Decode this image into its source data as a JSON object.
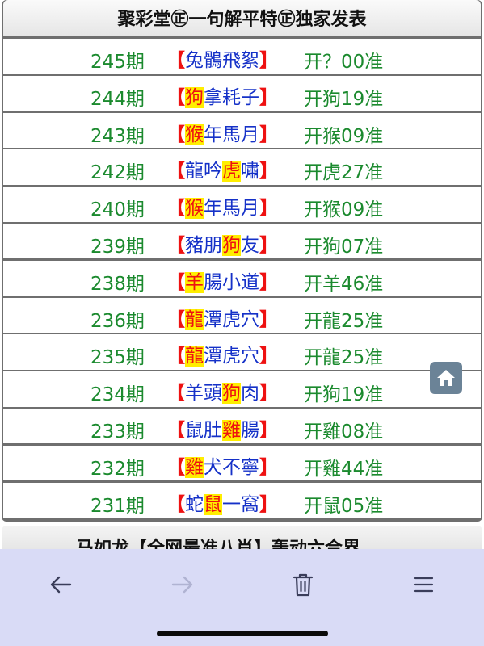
{
  "header": {
    "title": "聚彩堂㊣一句解平特㊣独家发表"
  },
  "rows": [
    {
      "period": "245期",
      "left": "【",
      "pre": "兔鶻飛絮",
      "hl": "",
      "post": "",
      "right": "】",
      "result": "开？00准"
    },
    {
      "period": "244期",
      "left": "【",
      "pre": "",
      "hl": "狗",
      "post": "拿耗子",
      "right": "】",
      "result": "开狗19准"
    },
    {
      "period": "243期",
      "left": "【",
      "pre": "",
      "hl": "猴",
      "post": "年馬月",
      "right": "】",
      "result": "开猴09准"
    },
    {
      "period": "242期",
      "left": "【",
      "pre": "龍吟",
      "hl": "虎",
      "post": "嘯",
      "right": "】",
      "result": "开虎27准"
    },
    {
      "period": "240期",
      "left": "【",
      "pre": "",
      "hl": "猴",
      "post": "年馬月",
      "right": "】",
      "result": "开猴09准"
    },
    {
      "period": "239期",
      "left": "【",
      "pre": "豬朋",
      "hl": "狗",
      "post": "友",
      "right": "】",
      "result": "开狗07准"
    },
    {
      "period": "238期",
      "left": "【",
      "pre": "",
      "hl": "羊",
      "post": "腸小道",
      "right": "】",
      "result": "开羊46准"
    },
    {
      "period": "236期",
      "left": "【",
      "pre": "",
      "hl": "龍",
      "post": "潭虎穴",
      "right": "】",
      "result": "开龍25准"
    },
    {
      "period": "235期",
      "left": "【",
      "pre": "",
      "hl": "龍",
      "post": "潭虎穴",
      "right": "】",
      "result": "开龍25准"
    },
    {
      "period": "234期",
      "left": "【",
      "pre": "羊頭",
      "hl": "狗",
      "post": "肉",
      "right": "】",
      "result": "开狗19准"
    },
    {
      "period": "233期",
      "left": "【",
      "pre": "鼠肚",
      "hl": "雞",
      "post": "腸",
      "right": "】",
      "result": "开雞08准"
    },
    {
      "period": "232期",
      "left": "【",
      "pre": "",
      "hl": "雞",
      "post": "犬不寧",
      "right": "】",
      "result": "开雞44准"
    },
    {
      "period": "231期",
      "left": "【",
      "pre": "蛇",
      "hl": "鼠",
      "post": "一窩",
      "right": "】",
      "result": "开鼠05准"
    }
  ],
  "next_panel": {
    "title": "马如龙【全网最准八肖】轰动六合界"
  },
  "toolbar": {
    "back_icon": "arrow-left-icon",
    "forward_icon": "arrow-right-icon",
    "trash_icon": "trash-icon",
    "menu_icon": "hamburger-menu-icon"
  },
  "floating": {
    "home_icon": "home-icon"
  },
  "colors": {
    "period": "#1b8a2e",
    "bracket": "#ee1111",
    "phrase": "#1531c8",
    "highlight_bg": "#ffee00",
    "toolbar_bg": "#d9dbf6"
  }
}
